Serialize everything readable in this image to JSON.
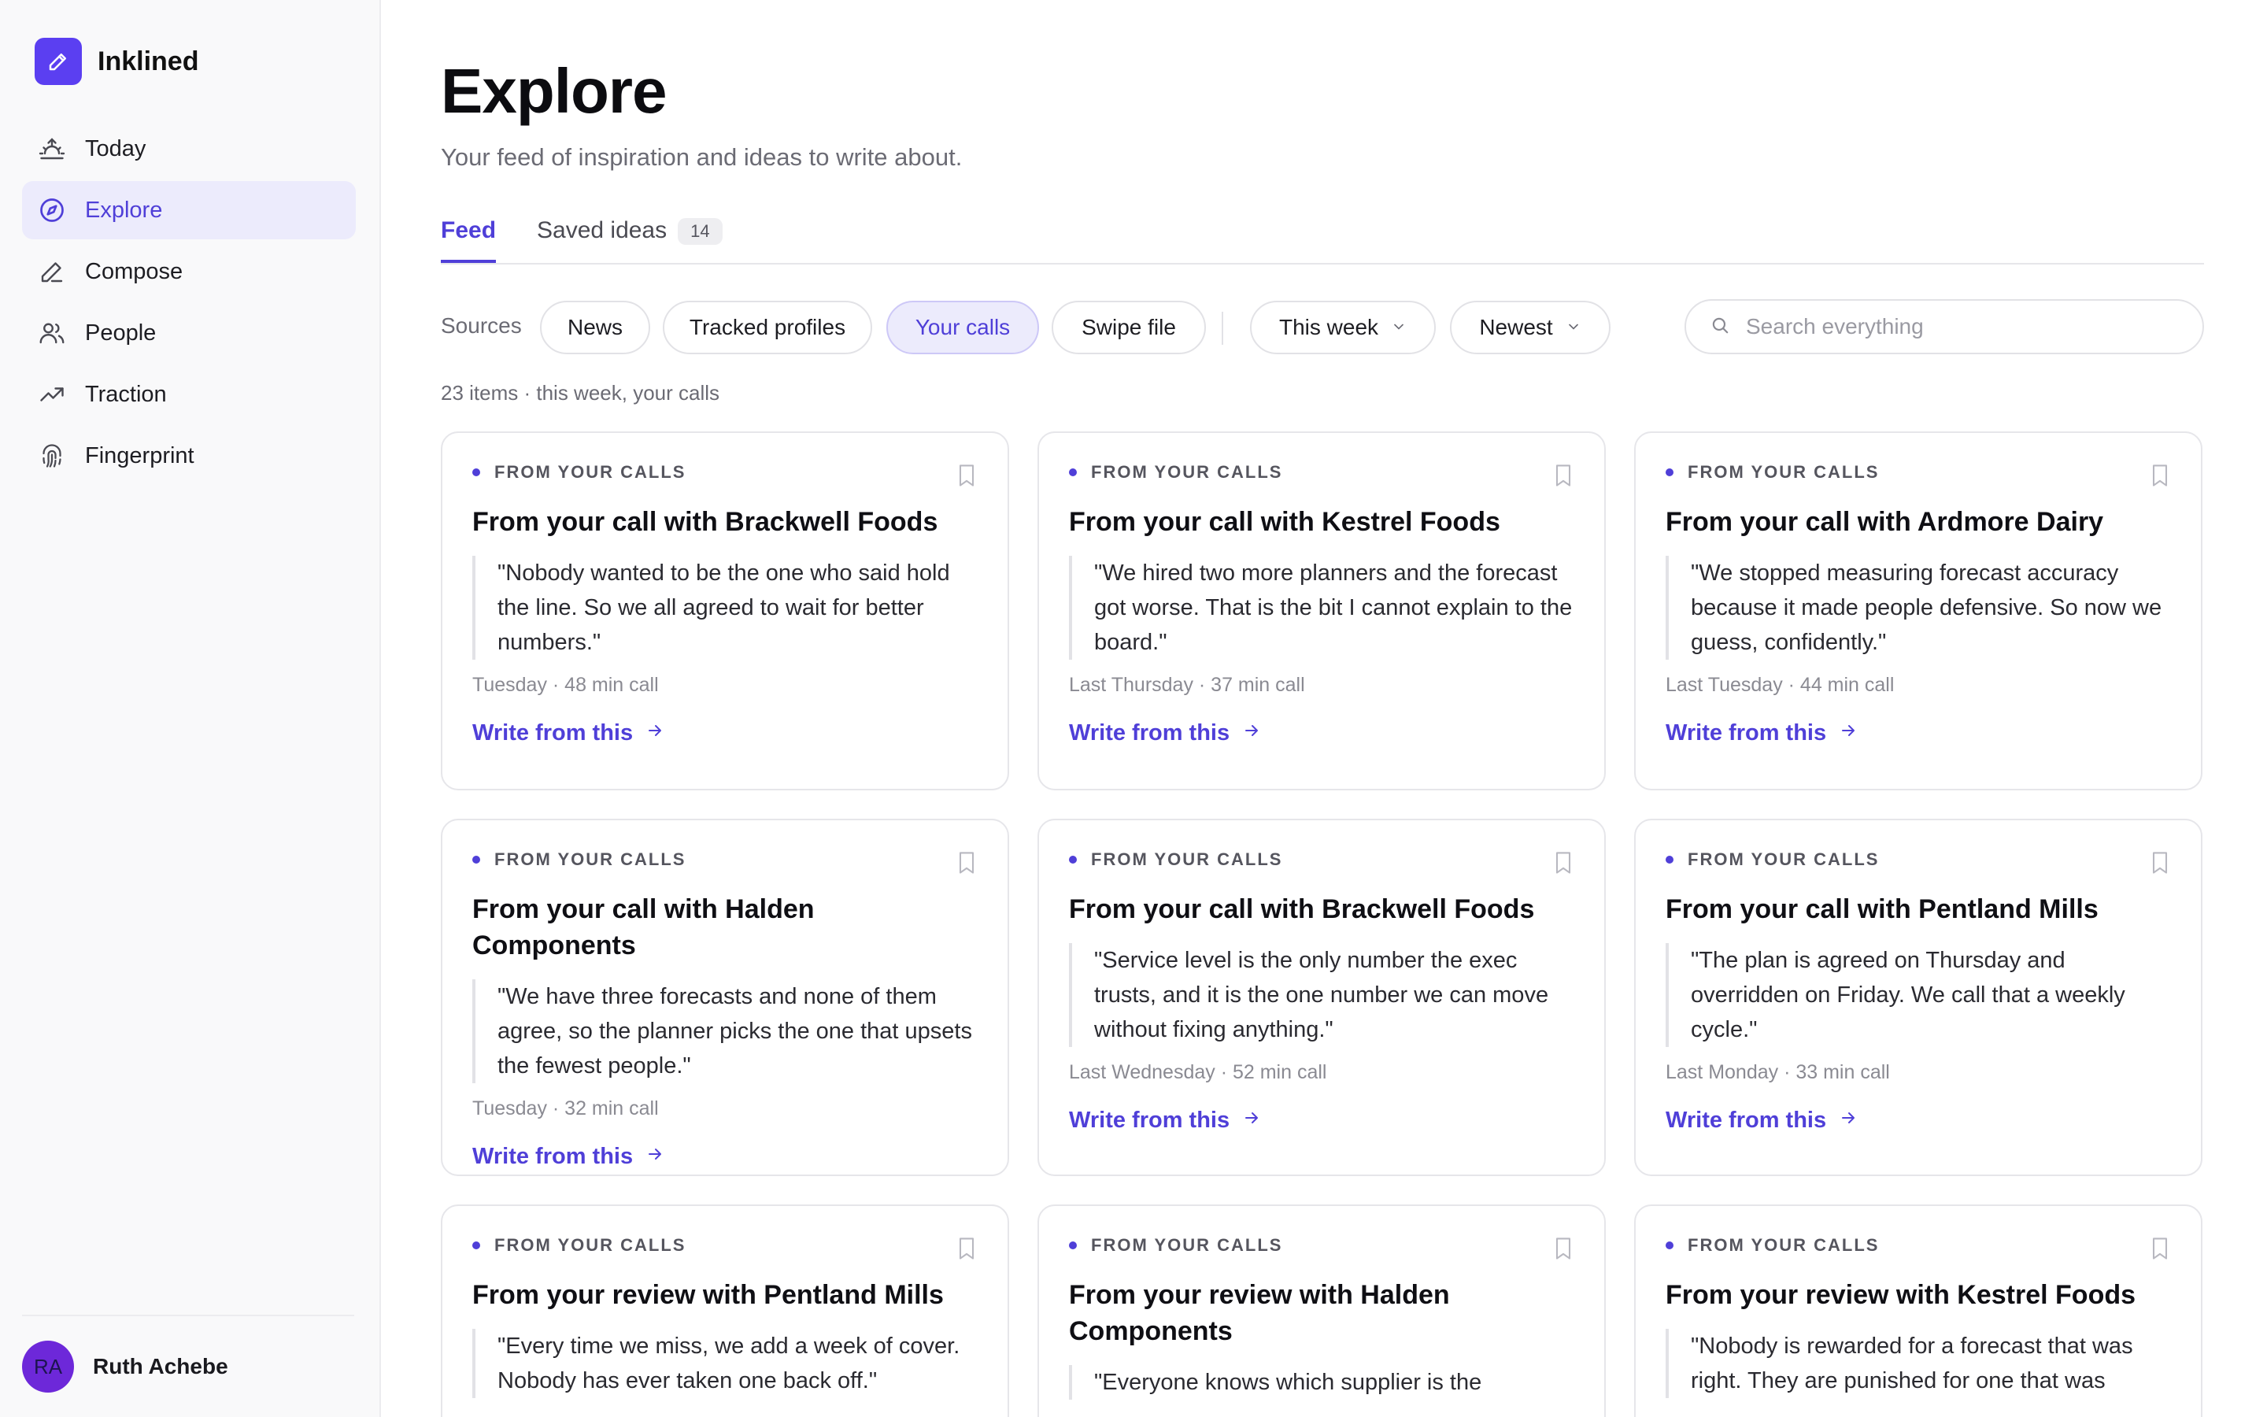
{
  "app": {
    "name": "Inklined"
  },
  "sidebar": {
    "items": [
      {
        "label": "Today",
        "icon": "sunrise-icon"
      },
      {
        "label": "Explore",
        "icon": "compass-icon",
        "active": true
      },
      {
        "label": "Compose",
        "icon": "pencil-icon"
      },
      {
        "label": "People",
        "icon": "users-icon"
      },
      {
        "label": "Traction",
        "icon": "trend-icon"
      },
      {
        "label": "Fingerprint",
        "icon": "fingerprint-icon"
      }
    ],
    "user": {
      "initials": "RA",
      "name": "Ruth Achebe"
    }
  },
  "page": {
    "title": "Explore",
    "subtitle": "Your feed of inspiration and ideas to write about."
  },
  "tabs": {
    "feed": "Feed",
    "saved": "Saved ideas",
    "saved_count": "14"
  },
  "filters": {
    "label": "Sources",
    "sources": [
      "News",
      "Tracked profiles",
      "Your calls",
      "Swipe file"
    ],
    "active_source": "Your calls",
    "time": "This week",
    "sort": "Newest",
    "search_placeholder": "Search everything"
  },
  "results": {
    "summary": "23 items · this week, your calls"
  },
  "cards": [
    {
      "eyebrow": "FROM YOUR CALLS",
      "title": "From your call with Brackwell Foods",
      "quote": "\"Nobody wanted to be the one who said hold the line. So we all agreed to wait for better numbers.\"",
      "meta": "Tuesday · 48 min call",
      "cta": "Write from this"
    },
    {
      "eyebrow": "FROM YOUR CALLS",
      "title": "From your call with Kestrel Foods",
      "quote": "\"We hired two more planners and the forecast got worse. That is the bit I cannot explain to the board.\"",
      "meta": "Last Thursday · 37 min call",
      "cta": "Write from this"
    },
    {
      "eyebrow": "FROM YOUR CALLS",
      "title": "From your call with Ardmore Dairy",
      "quote": "\"We stopped measuring forecast accuracy because it made people defensive. So now we guess, confidently.\"",
      "meta": "Last Tuesday · 44 min call",
      "cta": "Write from this"
    },
    {
      "eyebrow": "FROM YOUR CALLS",
      "title": "From your call with Halden Components",
      "quote": "\"We have three forecasts and none of them agree, so the planner picks the one that upsets the fewest people.\"",
      "meta": "Tuesday · 32 min call",
      "cta": "Write from this"
    },
    {
      "eyebrow": "FROM YOUR CALLS",
      "title": "From your call with Brackwell Foods",
      "quote": "\"Service level is the only number the exec trusts, and it is the one number we can move without fixing anything.\"",
      "meta": "Last Wednesday · 52 min call",
      "cta": "Write from this"
    },
    {
      "eyebrow": "FROM YOUR CALLS",
      "title": "From your call with Pentland Mills",
      "quote": "\"The plan is agreed on Thursday and overridden on Friday. We call that a weekly cycle.\"",
      "meta": "Last Monday · 33 min call",
      "cta": "Write from this"
    },
    {
      "eyebrow": "FROM YOUR CALLS",
      "title": "From your review with Pentland Mills",
      "quote": "\"Every time we miss, we add a week of cover. Nobody has ever taken one back off.\"",
      "meta": "",
      "cta": ""
    },
    {
      "eyebrow": "FROM YOUR CALLS",
      "title": "From your review with Halden Components",
      "quote": "\"Everyone knows which supplier is the",
      "meta": "",
      "cta": ""
    },
    {
      "eyebrow": "FROM YOUR CALLS",
      "title": "From your review with Kestrel Foods",
      "quote": "\"Nobody is rewarded for a forecast that was right. They are punished for one that was",
      "meta": "",
      "cta": ""
    }
  ],
  "colors": {
    "accent": "#4f3fd8",
    "brand": "#5b3ff1",
    "avatar": "#6d28d9"
  }
}
